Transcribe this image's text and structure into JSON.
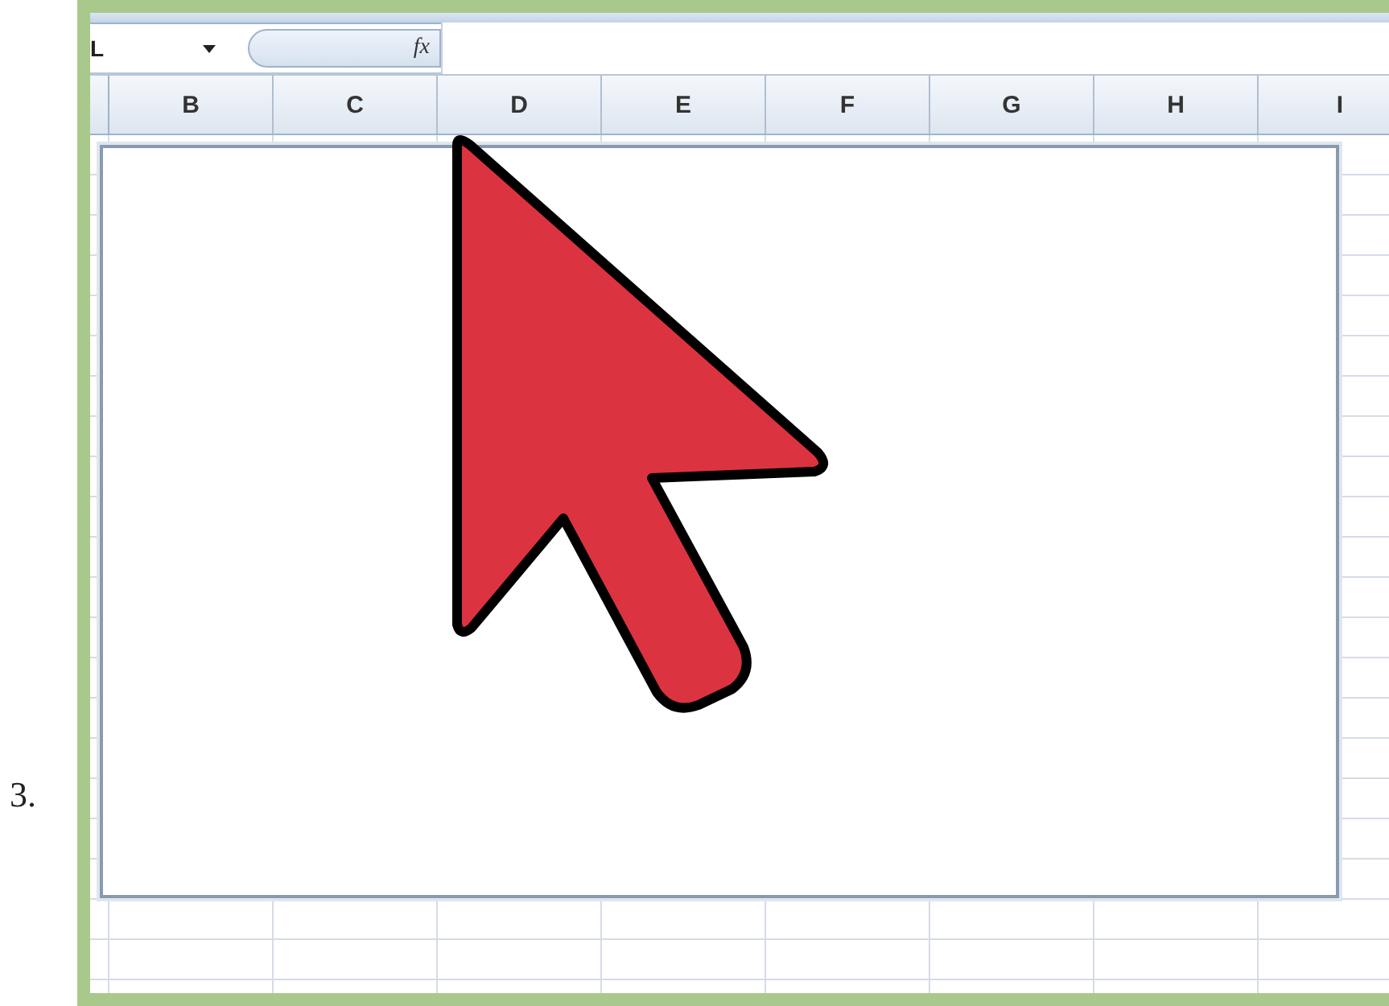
{
  "step_number": "3.",
  "formula_bar": {
    "name_box": "L",
    "function_label": "fx"
  },
  "columns": [
    "B",
    "C",
    "D",
    "E",
    "F",
    "G",
    "H",
    "I"
  ]
}
